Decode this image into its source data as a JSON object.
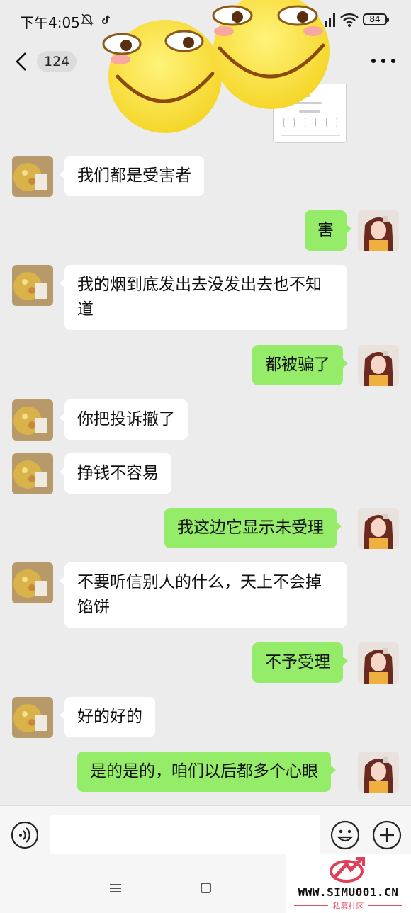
{
  "status_bar": {
    "time": "下午4:05",
    "battery": "84"
  },
  "nav": {
    "unread_count": "124"
  },
  "messages": [
    {
      "side": "in",
      "text": "我们都是受害者"
    },
    {
      "side": "out",
      "text": "害"
    },
    {
      "side": "in",
      "text": "我的烟到底发出去没发出去也不知道"
    },
    {
      "side": "out",
      "text": "都被骗了"
    },
    {
      "side": "in",
      "text": "你把投诉撤了"
    },
    {
      "side": "in",
      "text": "挣钱不容易"
    },
    {
      "side": "out",
      "text": "我这边它显示未受理"
    },
    {
      "side": "in",
      "text": "不要听信别人的什么，天上不会掉馅饼"
    },
    {
      "side": "out",
      "text": "不予受理"
    },
    {
      "side": "in",
      "text": "好的好的"
    },
    {
      "side": "out",
      "text": "是的是的，咱们以后都多个心眼"
    }
  ],
  "input": {
    "placeholder": ""
  },
  "watermark": {
    "url": "WWW.SIMU001.CN",
    "sub": "私募社区"
  },
  "colors": {
    "background": "#ececec",
    "incoming_bubble": "#ffffff",
    "outgoing_bubble": "#95ec69",
    "input_bar": "#f6f6f6"
  }
}
